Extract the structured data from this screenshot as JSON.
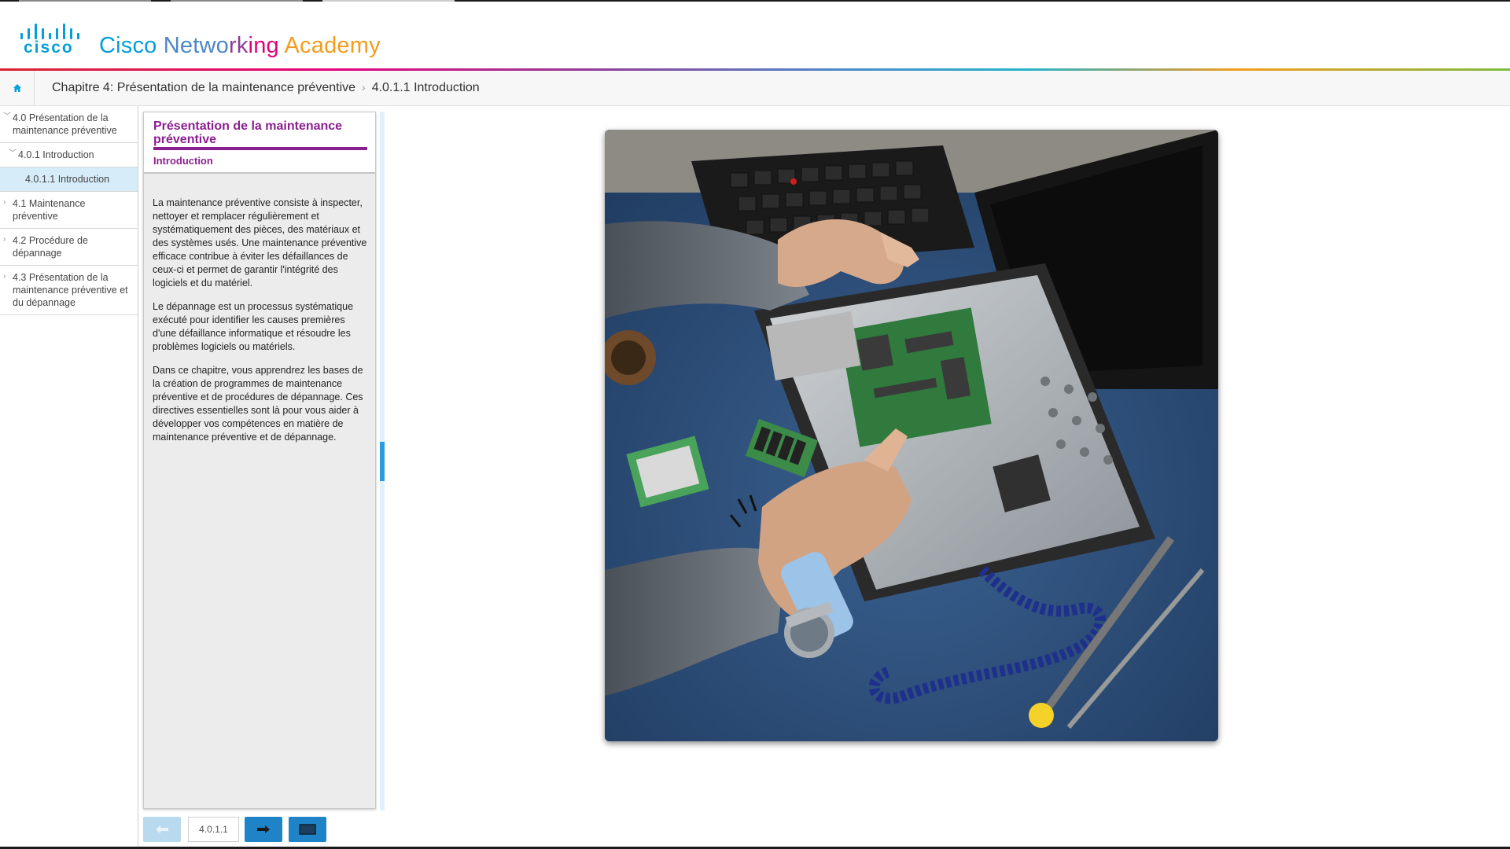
{
  "app": {
    "brand": [
      {
        "text": "Cisco ",
        "color": "#049fd9"
      },
      {
        "text": "Netwo",
        "color": "#4e87c6"
      },
      {
        "text": "rk",
        "color": "#8e3e98"
      },
      {
        "text": "ing ",
        "color": "#e4007c"
      },
      {
        "text": "Academy",
        "color": "#f39c1f"
      }
    ],
    "logo_word": "cisco",
    "accent_color": "#049fd9",
    "title_color": "#8a1f8f"
  },
  "breadcrumb": {
    "home_icon": "home-icon",
    "chapter": "Chapitre 4: Présentation de la maintenance préventive",
    "separator": "›",
    "current": "4.0.1.1 Introduction"
  },
  "sidebar": {
    "items": [
      {
        "label": "4.0 Présentation de la maintenance préventive",
        "level": 1,
        "expanded": true
      },
      {
        "label": "4.0.1 Introduction",
        "level": 2,
        "expanded": true
      },
      {
        "label": "4.0.1.1 Introduction",
        "level": 3,
        "selected": true
      },
      {
        "label": "4.1 Maintenance préventive",
        "level": 1,
        "expanded": false
      },
      {
        "label": "4.2 Procédure de dépannage",
        "level": 1,
        "expanded": false
      },
      {
        "label": "4.3 Présentation de la maintenance préventive et du dépannage",
        "level": 1,
        "expanded": false
      }
    ]
  },
  "panel": {
    "title": "Présentation de la maintenance préventive",
    "subtitle": "Introduction",
    "paragraphs": [
      "La maintenance préventive consiste à inspecter, nettoyer et remplacer régulièrement et systématiquement des pièces, des matériaux et des systèmes usés. Une maintenance préventive efficace contribue à éviter les défaillances de ceux-ci et permet de garantir l'intégrité des logiciels et du matériel.",
      "Le dépannage est un processus systématique exécuté pour identifier les causes premières d'une défaillance informatique et résoudre les problèmes logiciels ou matériels.",
      "Dans ce chapitre, vous apprendrez les bases de la création de programmes de maintenance préventive et de procédures de dépannage. Ces directives essentielles sont là pour vous aider à développer vos compétences en matière de maintenance préventive et de dépannage."
    ]
  },
  "footer": {
    "page_number": "4.0.1.1",
    "prev_icon": "arrow-left-icon",
    "next_icon": "arrow-right-icon",
    "screen_icon": "screen-icon"
  }
}
